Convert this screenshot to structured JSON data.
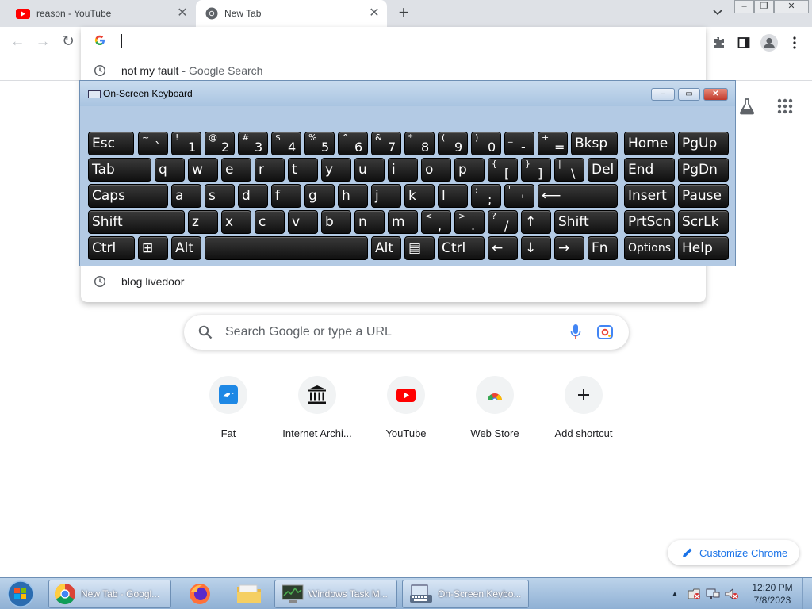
{
  "browser": {
    "tabs": [
      {
        "title": "reason - YouTube",
        "icon": "youtube-icon",
        "active": false
      },
      {
        "title": "New Tab",
        "icon": "chrome-icon",
        "active": true
      }
    ],
    "new_tab_symbol": "+",
    "window_controls": [
      "–",
      "❐",
      "✕"
    ]
  },
  "omnibox": {
    "value": "",
    "suggestions": [
      {
        "text": "not my fault",
        "secondary": "Google Search"
      },
      {
        "text": "blog livedoor",
        "secondary": ""
      }
    ]
  },
  "osk": {
    "title": "On-Screen Keyboard",
    "rows": [
      [
        {
          "label": "Esc"
        },
        {
          "top": "~",
          "bottom": "`"
        },
        {
          "top": "!",
          "bottom": "1"
        },
        {
          "top": "@",
          "bottom": "2"
        },
        {
          "top": "#",
          "bottom": "3"
        },
        {
          "top": "$",
          "bottom": "4"
        },
        {
          "top": "%",
          "bottom": "5"
        },
        {
          "top": "^",
          "bottom": "6"
        },
        {
          "top": "&",
          "bottom": "7"
        },
        {
          "top": "*",
          "bottom": "8"
        },
        {
          "top": "(",
          "bottom": "9"
        },
        {
          "top": ")",
          "bottom": "0"
        },
        {
          "top": "_",
          "bottom": "-"
        },
        {
          "top": "+",
          "bottom": "="
        },
        {
          "label": "Bksp"
        },
        {
          "label": "Home"
        },
        {
          "label": "PgUp"
        }
      ],
      [
        {
          "label": "Tab"
        },
        {
          "label": "q"
        },
        {
          "label": "w"
        },
        {
          "label": "e"
        },
        {
          "label": "r"
        },
        {
          "label": "t"
        },
        {
          "label": "y"
        },
        {
          "label": "u"
        },
        {
          "label": "i"
        },
        {
          "label": "o"
        },
        {
          "label": "p"
        },
        {
          "top": "{",
          "bottom": "["
        },
        {
          "top": "}",
          "bottom": "]"
        },
        {
          "top": "|",
          "bottom": "\\"
        },
        {
          "label": "Del"
        },
        {
          "label": "End"
        },
        {
          "label": "PgDn"
        }
      ],
      [
        {
          "label": "Caps"
        },
        {
          "label": "a"
        },
        {
          "label": "s"
        },
        {
          "label": "d"
        },
        {
          "label": "f"
        },
        {
          "label": "g"
        },
        {
          "label": "h"
        },
        {
          "label": "j"
        },
        {
          "label": "k"
        },
        {
          "label": "l"
        },
        {
          "top": ":",
          "bottom": ";"
        },
        {
          "top": "\"",
          "bottom": "'"
        },
        {
          "label": "⟵"
        },
        {
          "label": "Insert"
        },
        {
          "label": "Pause"
        }
      ],
      [
        {
          "label": "Shift"
        },
        {
          "label": "z"
        },
        {
          "label": "x"
        },
        {
          "label": "c"
        },
        {
          "label": "v"
        },
        {
          "label": "b"
        },
        {
          "label": "n"
        },
        {
          "label": "m"
        },
        {
          "top": "<",
          "bottom": ","
        },
        {
          "top": ">",
          "bottom": "."
        },
        {
          "top": "?",
          "bottom": "/"
        },
        {
          "label": "↑"
        },
        {
          "label": "Shift"
        },
        {
          "label": "PrtScn"
        },
        {
          "label": "ScrLk"
        }
      ],
      [
        {
          "label": "Ctrl"
        },
        {
          "label": "⊞"
        },
        {
          "label": "Alt"
        },
        {
          "label": ""
        },
        {
          "label": "Alt"
        },
        {
          "label": "▤"
        },
        {
          "label": "Ctrl"
        },
        {
          "label": "←"
        },
        {
          "label": "↓"
        },
        {
          "label": "→"
        },
        {
          "label": "Fn"
        },
        {
          "label": "Options"
        },
        {
          "label": "Help"
        }
      ]
    ]
  },
  "ntp": {
    "search_placeholder": "Search Google or type a URL",
    "shortcuts": [
      {
        "label": "Fat",
        "icon": "fat-icon"
      },
      {
        "label": "Internet Archi...",
        "icon": "archive-icon"
      },
      {
        "label": "YouTube",
        "icon": "youtube-icon"
      },
      {
        "label": "Web Store",
        "icon": "webstore-icon"
      },
      {
        "label": "Add shortcut",
        "icon": "plus-icon"
      }
    ],
    "customize_label": "Customize Chrome"
  },
  "taskbar": {
    "items": [
      {
        "label": "New Tab - Googl...",
        "icon": "chrome-icon"
      },
      {
        "label": "",
        "icon": "firefox-icon"
      },
      {
        "label": "",
        "icon": "folder-icon"
      },
      {
        "label": "Windows Task M...",
        "icon": "task-manager-icon"
      },
      {
        "label": "On-Screen Keybo...",
        "icon": "keyboard-icon"
      }
    ],
    "time": "12:20 PM",
    "date": "7/8/2023"
  },
  "colors": {
    "accent": "#1a73e8",
    "tab_strip": "#dee1e6",
    "key_face": "#1a1a1a",
    "osk_frame": "#a8c3e0"
  }
}
